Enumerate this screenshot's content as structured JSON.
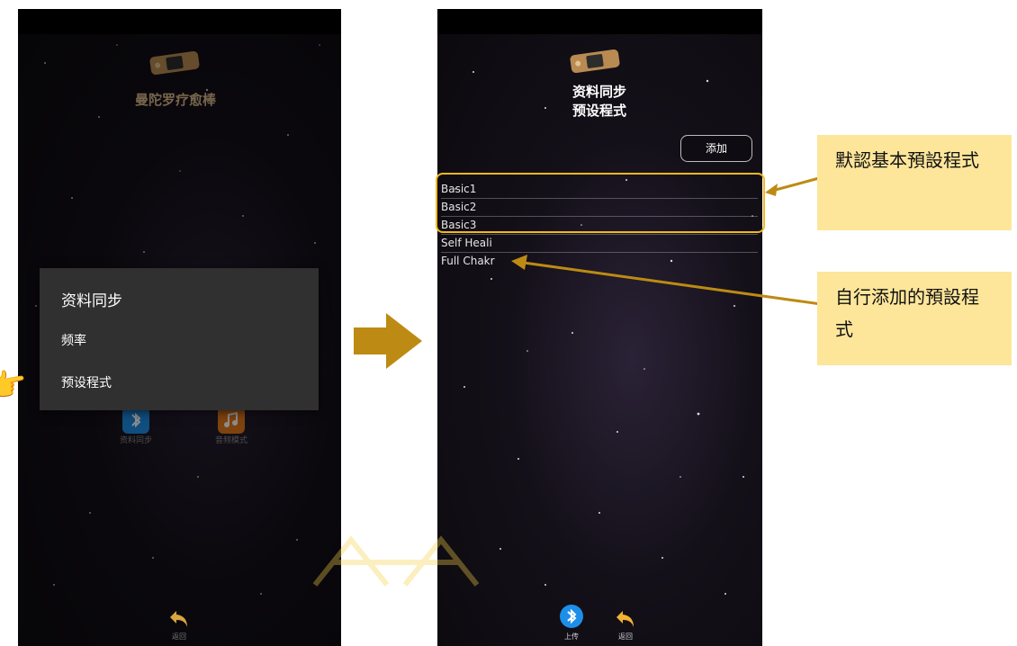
{
  "left_screen": {
    "app_title": "曼陀罗疗愈棒",
    "modes": [
      {
        "label": "资料同步",
        "icon": "bluetooth-icon"
      },
      {
        "label": "音频模式",
        "icon": "music-note-icon"
      }
    ],
    "dialog": {
      "title": "资料同步",
      "items": [
        "频率",
        "预设程式"
      ]
    },
    "bottom": {
      "back_label": "返回"
    }
  },
  "right_screen": {
    "title_line1": "资料同步",
    "title_line2": "预设程式",
    "add_button": "添加",
    "presets": [
      "Basic1",
      "Basic2",
      "Basic3",
      "Self Heali",
      "Full Chakr"
    ],
    "bottom": {
      "upload_label": "上传",
      "back_label": "返回"
    }
  },
  "annotations": {
    "default_presets": "默認基本預設程式",
    "custom_presets": "自行添加的預設程式"
  },
  "colors": {
    "highlight": "#f3b81c",
    "note_bg": "#fde69a",
    "arrow": "#bd8b13",
    "title_gold": "#d9b98a"
  }
}
